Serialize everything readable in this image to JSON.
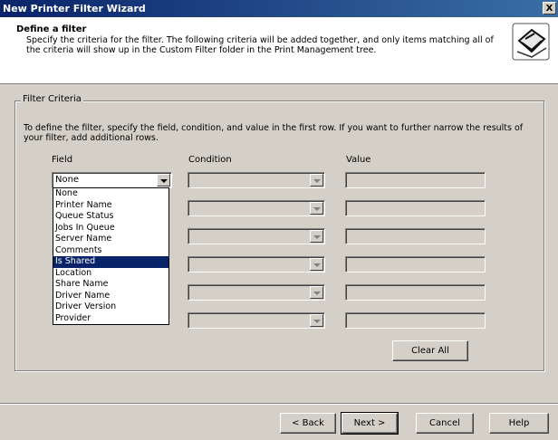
{
  "window": {
    "title": "New Printer Filter Wizard",
    "close_label": "X"
  },
  "header": {
    "title": "Define a filter",
    "description": "Specify the criteria for the filter. The following criteria will be added together, and only items matching all of the criteria will show up in the Custom Filter folder in the Print Management tree.",
    "icon": "printer-filter-icon"
  },
  "criteria": {
    "legend": "Filter Criteria",
    "description": "To define the filter, specify the field, condition, and value in the first row. If you want to further narrow the results of your filter, add additional rows.",
    "columns": {
      "field": "Field",
      "condition": "Condition",
      "value": "Value"
    },
    "first_field_value": "None",
    "dropdown_options": [
      "None",
      "Printer Name",
      "Queue Status",
      "Jobs In Queue",
      "Server Name",
      "Comments",
      "Is Shared",
      "Location",
      "Share Name",
      "Driver Name",
      "Driver Version",
      "Provider"
    ],
    "selected_option": "Is Shared",
    "clear_all_label": "Clear All"
  },
  "footer": {
    "back_label": "< Back",
    "next_label": "Next >",
    "cancel_label": "Cancel",
    "help_label": "Help"
  }
}
